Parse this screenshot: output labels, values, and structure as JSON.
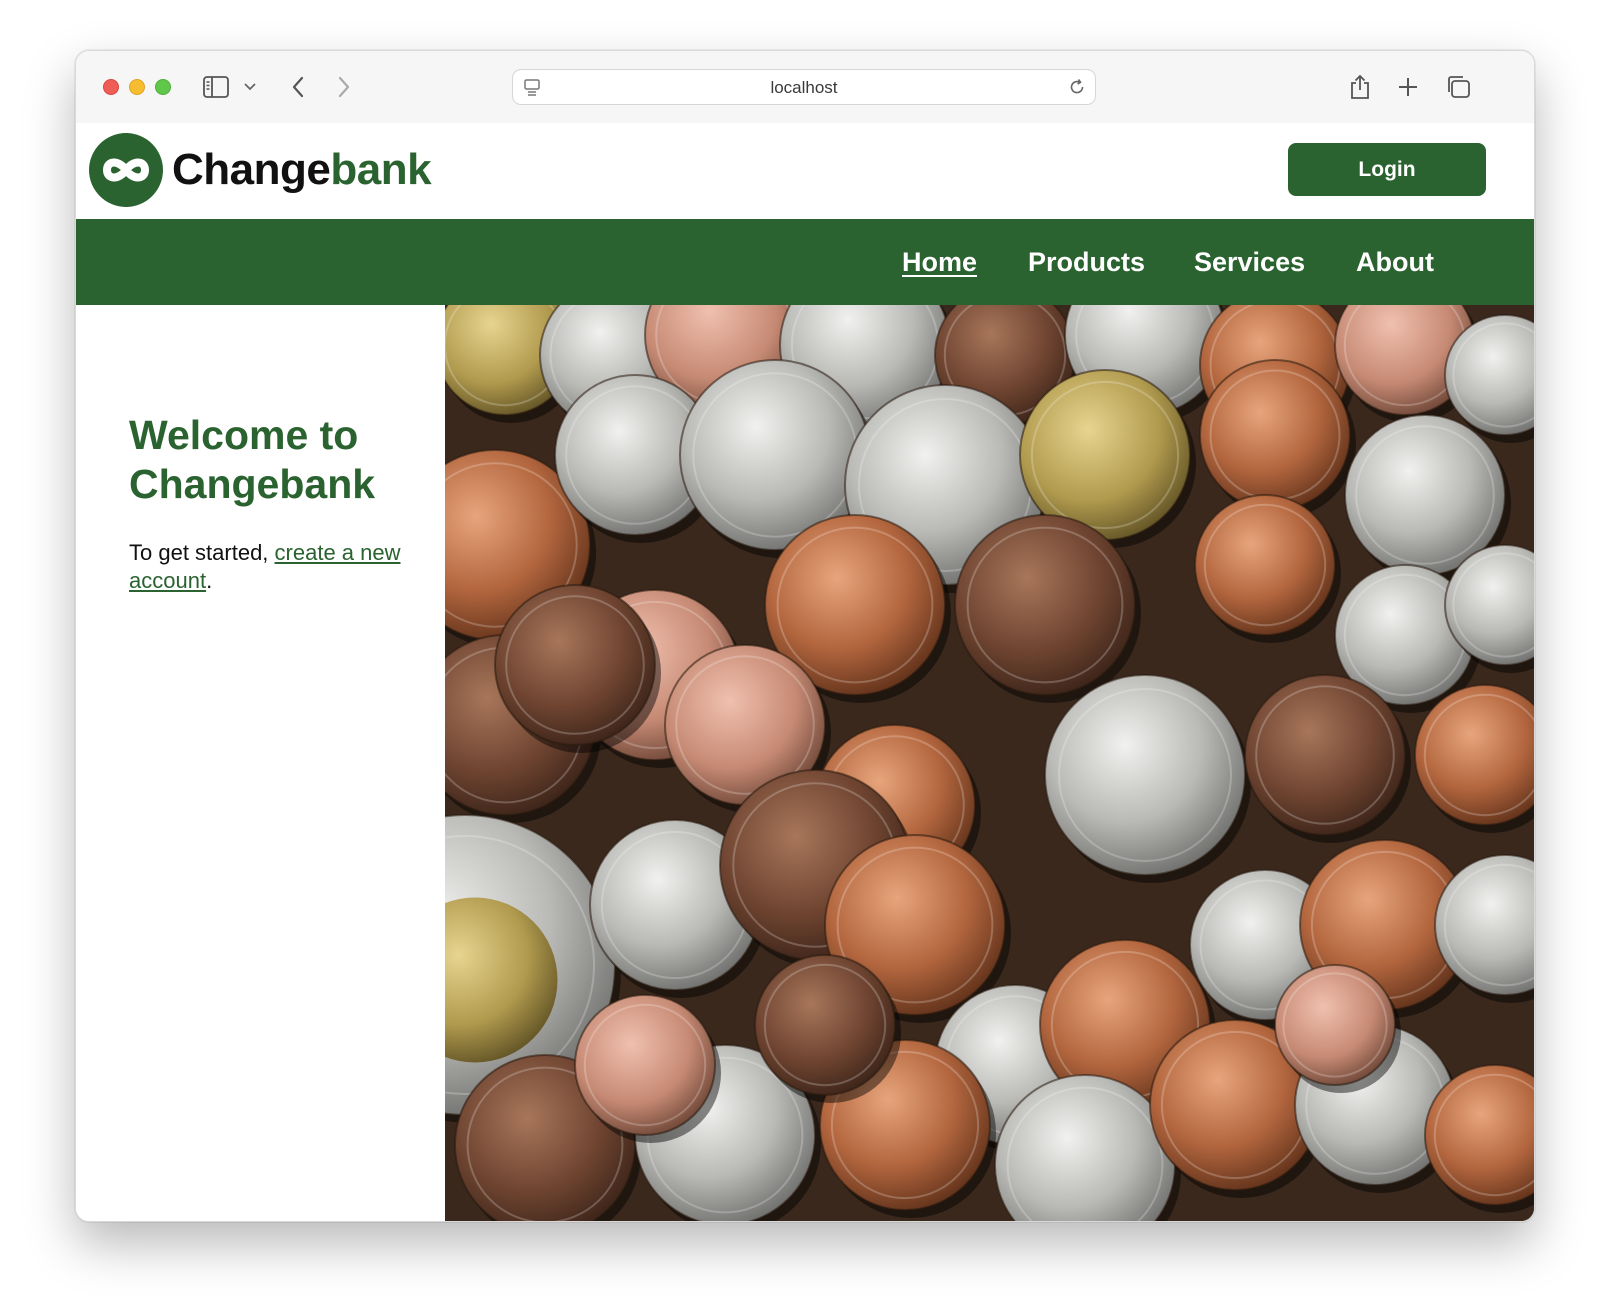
{
  "browser": {
    "address": "localhost",
    "icons": [
      "sidebar-icon",
      "chevron-down-icon",
      "back-icon",
      "forward-icon",
      "site-icon",
      "reload-icon",
      "share-icon",
      "new-tab-icon",
      "tabs-overview-icon"
    ]
  },
  "header": {
    "brand_prefix": "Change",
    "brand_suffix": "bank",
    "login_label": "Login",
    "brand_color": "#2a6330"
  },
  "nav": {
    "items": [
      {
        "label": "Home",
        "active": true
      },
      {
        "label": "Products"
      },
      {
        "label": "Services"
      },
      {
        "label": "About"
      }
    ]
  },
  "main": {
    "heading": "Welcome to Changebank",
    "intro_prefix": "To get started, ",
    "intro_link": "create a new account",
    "intro_suffix": ".",
    "hero_image": "pile-of-canadian-coins-photo"
  }
}
